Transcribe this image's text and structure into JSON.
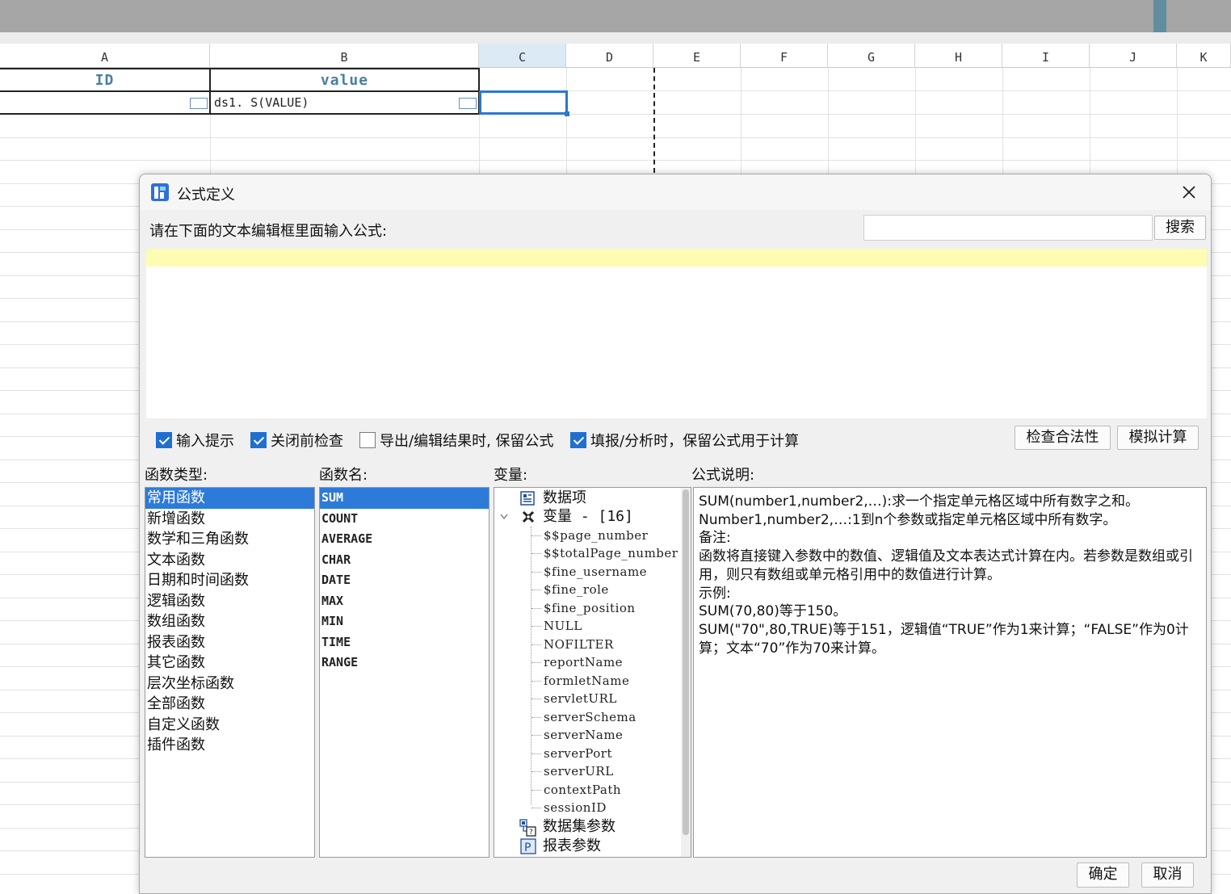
{
  "sheet": {
    "columns": [
      "A",
      "B",
      "C",
      "D",
      "E",
      "F",
      "G",
      "H",
      "I",
      "J",
      "K"
    ],
    "header_id": "ID",
    "header_value": "value",
    "cell_b2": "ds1. S(VALUE)"
  },
  "dialog": {
    "title": "公式定义",
    "prompt": "请在下面的文本编辑框里面输入公式:",
    "search_value": "",
    "search_button": "搜索",
    "options": [
      {
        "label": "输入提示",
        "checked": true
      },
      {
        "label": "关闭前检查",
        "checked": true
      },
      {
        "label": "导出/编辑结果时, 保留公式",
        "checked": false
      },
      {
        "label": "填报/分析时，保留公式用于计算",
        "checked": true
      }
    ],
    "check_button": "检查合法性",
    "simulate_button": "模拟计算",
    "func_type_label": "函数类型:",
    "func_name_label": "函数名:",
    "variable_label": "变量:",
    "desc_label": "公式说明:",
    "func_types": [
      "常用函数",
      "新增函数",
      "数学和三角函数",
      "文本函数",
      "日期和时间函数",
      "逻辑函数",
      "数组函数",
      "报表函数",
      "其它函数",
      "层次坐标函数",
      "全部函数",
      "自定义函数",
      "插件函数"
    ],
    "func_names": [
      "SUM",
      "COUNT",
      "AVERAGE",
      "CHAR",
      "DATE",
      "MAX",
      "MIN",
      "TIME",
      "RANGE"
    ],
    "tree": {
      "data_items": "数据项",
      "variables": "变量 - [16]",
      "variable_items": [
        "$$page_number",
        "$$totalPage_number",
        "$fine_username",
        "$fine_role",
        "$fine_position",
        "NULL",
        "NOFILTER",
        "reportName",
        "formletName",
        "servletURL",
        "serverSchema",
        "serverName",
        "serverPort",
        "serverURL",
        "contextPath",
        "sessionID"
      ],
      "dataset_params": "数据集参数",
      "report_params": "报表参数"
    },
    "description": [
      "SUM(number1,number2,…):求一个指定单元格区域中所有数字之和。",
      "Number1,number2,…:1到n个参数或指定单元格区域中所有数字。",
      "备注:",
      "函数将直接键入参数中的数值、逻辑值及文本表达式计算在内。若参数是数组或引用，则只有数组或单元格引用中的数值进行计算。",
      "示例:",
      "SUM(70,80)等于150。",
      "SUM(\"70\",80,TRUE)等于151，逻辑值“TRUE”作为1来计算；“FALSE”作为0计算；文本“70”作为70来计算。"
    ],
    "ok_button": "确定",
    "cancel_button": "取消"
  }
}
